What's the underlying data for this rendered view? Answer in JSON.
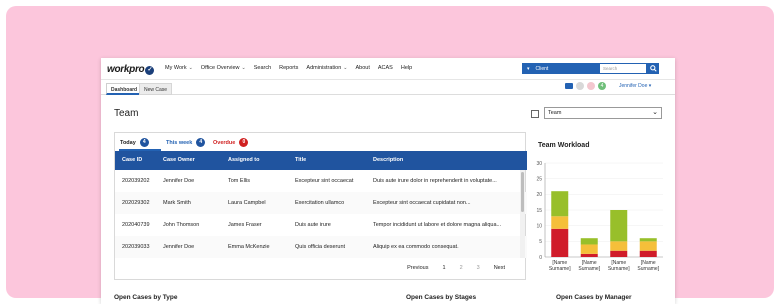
{
  "app": {
    "logo": "work",
    "logo_suffix": "pro",
    "menu": [
      "My Work",
      "Office Overview",
      "Search",
      "Reports",
      "Administration",
      "About",
      "ACAS",
      "Help"
    ],
    "menu_dropdowns": [
      true,
      true,
      false,
      false,
      true,
      false,
      false,
      false
    ],
    "search_scope": "Client",
    "search_placeholder": "Search"
  },
  "tabs": {
    "active": "Dashboard",
    "inactive": "New Case"
  },
  "header": {
    "user_name": "Jennifer Doe",
    "notification_count": "4"
  },
  "team": {
    "title": "Team",
    "selector_value": "Team"
  },
  "case_tabs": [
    {
      "label": "Today",
      "count": "4",
      "color": "#20549f"
    },
    {
      "label": "This week",
      "count": "4",
      "color": "#20549f"
    },
    {
      "label": "Overdue",
      "count": "0",
      "color": "#d02020"
    }
  ],
  "table": {
    "headers": [
      "Case ID",
      "Case Owner",
      "Assigned to",
      "Title",
      "Description"
    ],
    "rows": [
      [
        "202039202",
        "Jennifer Doe",
        "Tom Ellis",
        "Excepteur sint occaecat",
        "Duis aute irure dolor in reprehenderit in voluptate..."
      ],
      [
        "202029302",
        "Mark Smith",
        "Laura Campbel",
        "Exercitation ullamco",
        "Excepteur sint occaecat cupidatat non..."
      ],
      [
        "202040739",
        "John Thomson",
        "James Fraser",
        "Duis aute irure",
        "Tempor incididunt ut labore et dolore magna aliqua..."
      ],
      [
        "202039033",
        "Jennifer Doe",
        "Emma McKenzie",
        "Quis officia deserunt",
        "Aliquip ex ea commodo consequat."
      ]
    ]
  },
  "pager": {
    "prev": "Previous",
    "pages": [
      "1",
      "2",
      "3"
    ],
    "next": "Next"
  },
  "workload": {
    "title": "Team Workload",
    "chart_data": {
      "type": "bar",
      "stacked": true,
      "title": "Team Workload",
      "ylim": [
        0,
        30
      ],
      "yticks": [
        "30",
        "25",
        "20",
        "15",
        "10",
        "5",
        "0"
      ],
      "categories": [
        "[Name Surname]",
        "[Name Surname]",
        "[Name Surname]",
        "[Name Surname]"
      ],
      "series": [
        {
          "color": "#d01c2a",
          "values": [
            9,
            1,
            2,
            2
          ]
        },
        {
          "color": "#f5bf3a",
          "values": [
            4,
            3,
            3,
            3
          ]
        },
        {
          "color": "#98bf2a",
          "values": [
            8,
            2,
            10,
            1
          ]
        }
      ]
    }
  },
  "sections": [
    "Open Cases by Type",
    "Open Cases by Stages",
    "Open Cases by Manager"
  ]
}
